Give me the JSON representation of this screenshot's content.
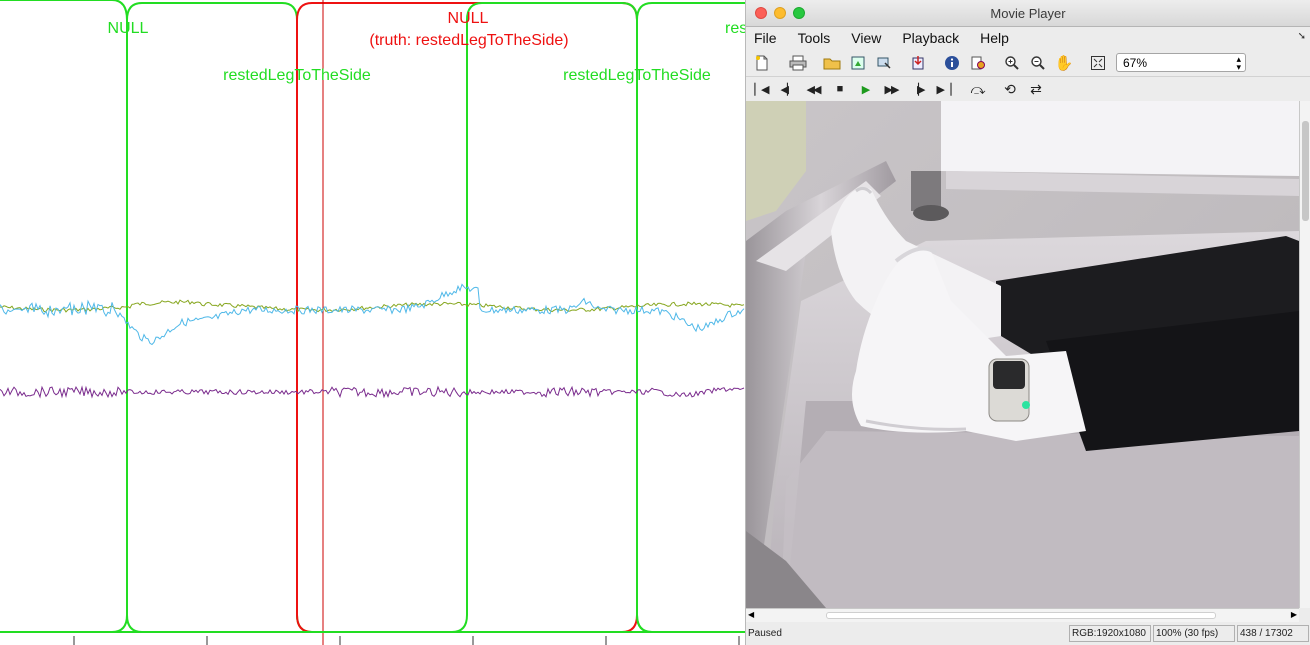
{
  "plot": {
    "segments": [
      {
        "label": "NULL",
        "truth": "",
        "color": "#22dd22"
      },
      {
        "label": "restedLegToTheSide",
        "truth": "",
        "color": "#22dd22"
      },
      {
        "label": "NULL",
        "truth": "(truth: restedLegToTheSide)",
        "color": "#ee1111"
      },
      {
        "label": "restedLegToTheSide",
        "truth": "",
        "color": "#22dd22"
      },
      {
        "label": "res",
        "truth": "",
        "color": "#22dd22"
      }
    ],
    "signal_colors": {
      "green": "#86a61e",
      "blue": "#4fb8e8",
      "purple": "#7a2b8d"
    },
    "cursor_color": "#cc0000"
  },
  "player": {
    "title": "Movie Player",
    "menu": [
      "File",
      "Tools",
      "View",
      "Playback",
      "Help"
    ],
    "toolbar_icons": [
      "new-file-icon",
      "print-icon",
      "open-folder-icon",
      "export-frame-icon",
      "frame-select-icon",
      "import-icon",
      "info-icon",
      "settings-icon",
      "zoom-in-icon",
      "zoom-out-icon",
      "pan-hand-icon",
      "fit-to-window-icon"
    ],
    "zoom_value": "67%",
    "playback_icons": [
      "go-to-first-icon",
      "previous-frame-icon",
      "rewind-icon",
      "stop-icon",
      "play-icon",
      "fast-forward-icon",
      "next-frame-icon",
      "go-to-last-icon",
      "jump-to-icon",
      "loop-icon",
      "swap-direction-icon"
    ],
    "status": {
      "state": "Paused",
      "rgb": "RGB:1920x1080",
      "speed": "100% (30 fps)",
      "frame": "438 / 17302"
    }
  }
}
